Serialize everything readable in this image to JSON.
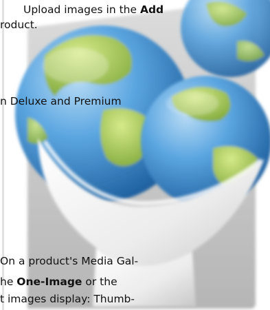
{
  "paragraph_1": {
    "line_1_text": "Upload images in the ",
    "line_1_bold": "Add",
    "line_2_text": "roduct."
  },
  "paragraph_2": {
    "line_1_text": "n Deluxe and Premium"
  },
  "paragraph_3": {
    "line_1_text": "On a product's Media Gal-",
    "line_2_prefix": "he ",
    "line_2_bold": "One-Image",
    "line_2_suffix": " or the",
    "line_3_text": "t images display: Thumb-"
  },
  "watermark": {
    "icon": "globe-bowl-icon",
    "colors": {
      "globe_blue": "#3d8fd6",
      "land_green": "#a9cc58",
      "bowl_white": "#f0f0f0",
      "backdrop_gray": "#bdbdbd"
    }
  }
}
